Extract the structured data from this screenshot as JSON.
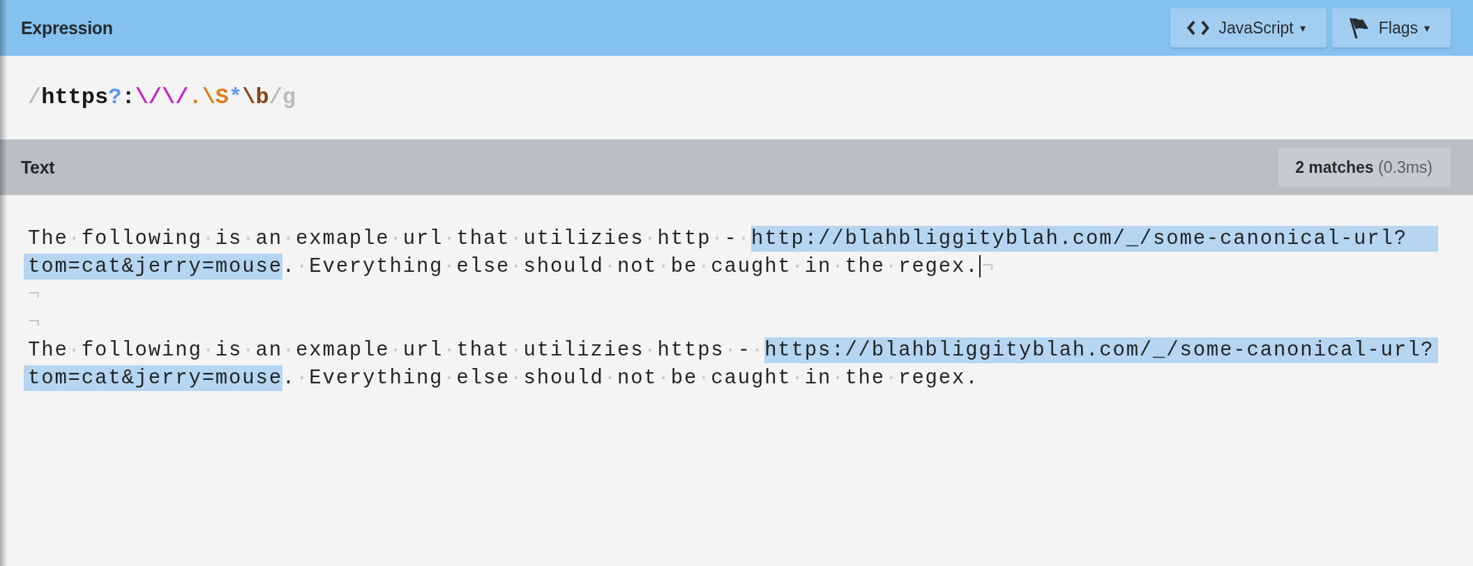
{
  "expression_panel": {
    "title": "Expression",
    "buttons": [
      {
        "kind": "language",
        "label": "JavaScript",
        "caret": "▾"
      },
      {
        "kind": "flags",
        "label": "Flags",
        "caret": "▾"
      }
    ],
    "tokens": [
      {
        "kind": "delimiter",
        "text": "/"
      },
      {
        "kind": "literal",
        "text": "https"
      },
      {
        "kind": "quantifier",
        "text": "?"
      },
      {
        "kind": "literal",
        "text": ":"
      },
      {
        "kind": "escape",
        "text": "\\/"
      },
      {
        "kind": "escape",
        "text": "\\/"
      },
      {
        "kind": "class",
        "text": "."
      },
      {
        "kind": "class",
        "text": "\\S"
      },
      {
        "kind": "quantifier",
        "text": "*"
      },
      {
        "kind": "anchor",
        "text": "\\b"
      },
      {
        "kind": "delimiter",
        "text": "/"
      },
      {
        "kind": "flags",
        "text": "g"
      }
    ]
  },
  "text_panel": {
    "title": "Text",
    "result": "**2 matches** (0.3ms)",
    "lines": [
      {
        "segments": [
          {
            "kind": "text",
            "parts": [
              "The",
              "·",
              "following",
              "·",
              "is",
              "·",
              "an",
              "·",
              "exmaple",
              "·",
              "url",
              "·",
              "that",
              "·",
              "utilizies",
              "·",
              "http",
              "·",
              "-",
              "·"
            ]
          },
          {
            "kind": "match",
            "text": "http://blahbliggityblah.com/_/some-canonical-url?"
          }
        ]
      },
      {
        "segments": [
          {
            "kind": "match",
            "text": "tom=cat&jerry=mouse"
          },
          {
            "kind": "text",
            "parts": [
              ".",
              "·",
              "Everything",
              "·",
              "else",
              "·",
              "should",
              "·",
              "not",
              "·",
              "be",
              "·",
              "caught",
              "·",
              "in",
              "·",
              "the",
              "·",
              "regex."
            ]
          },
          {
            "kind": "cursor"
          },
          {
            "kind": "eol",
            "text": "¬"
          }
        ]
      },
      {
        "segments": [
          {
            "kind": "eol",
            "text": "¬"
          }
        ]
      },
      {
        "segments": [
          {
            "kind": "eol",
            "text": "¬"
          }
        ]
      },
      {
        "segments": [
          {
            "kind": "text",
            "parts": [
              "The",
              "·",
              "following",
              "·",
              "is",
              "·",
              "an",
              "·",
              "exmaple",
              "·",
              "url",
              "·",
              "that",
              "·",
              "utilizies",
              "·",
              "https",
              "·",
              "-",
              "·"
            ]
          },
          {
            "kind": "match",
            "text": "https://blahbliggityblah.com/_/some-canonical-url?"
          }
        ]
      },
      {
        "segments": [
          {
            "kind": "match",
            "text": "tom=cat&jerry=mouse"
          },
          {
            "kind": "text",
            "parts": [
              ".",
              "·",
              "Everything",
              "·",
              "else",
              "·",
              "should",
              "·",
              "not",
              "·",
              "be",
              "·",
              "caught",
              "·",
              "in",
              "·",
              "the",
              "·",
              "regex."
            ]
          }
        ]
      }
    ]
  }
}
